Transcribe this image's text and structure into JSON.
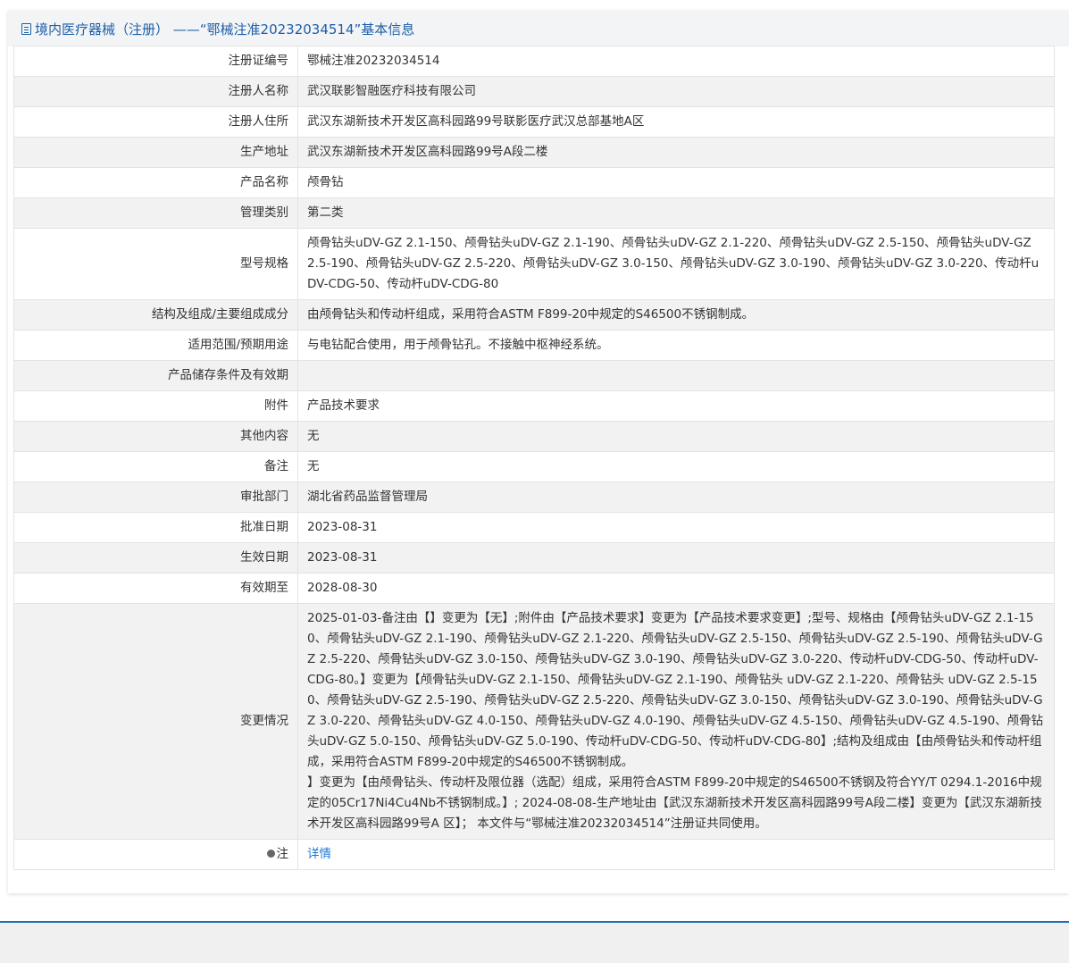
{
  "header": {
    "title": "境内医疗器械（注册） ——“鄂械注准20232034514”基本信息"
  },
  "rows": [
    {
      "label": "注册证编号",
      "value": "鄂械注准20232034514"
    },
    {
      "label": "注册人名称",
      "value": "武汉联影智融医疗科技有限公司"
    },
    {
      "label": "注册人住所",
      "value": "武汉东湖新技术开发区高科园路99号联影医疗武汉总部基地A区"
    },
    {
      "label": "生产地址",
      "value": "武汉东湖新技术开发区高科园路99号A段二楼"
    },
    {
      "label": "产品名称",
      "value": "颅骨钻"
    },
    {
      "label": "管理类别",
      "value": "第二类"
    },
    {
      "label": "型号规格",
      "value": "颅骨钻头uDV-GZ 2.1-150、颅骨钻头uDV-GZ 2.1-190、颅骨钻头uDV-GZ 2.1-220、颅骨钻头uDV-GZ 2.5-150、颅骨钻头uDV-GZ 2.5-190、颅骨钻头uDV-GZ 2.5-220、颅骨钻头uDV-GZ 3.0-150、颅骨钻头uDV-GZ 3.0-190、颅骨钻头uDV-GZ 3.0-220、传动杆uDV-CDG-50、传动杆uDV-CDG-80"
    },
    {
      "label": "结构及组成/主要组成成分",
      "value": "由颅骨钻头和传动杆组成，采用符合ASTM F899-20中规定的S46500不锈钢制成。"
    },
    {
      "label": "适用范围/预期用途",
      "value": "与电钻配合使用，用于颅骨钻孔。不接触中枢神经系统。"
    },
    {
      "label": "产品储存条件及有效期",
      "value": ""
    },
    {
      "label": "附件",
      "value": "产品技术要求"
    },
    {
      "label": "其他内容",
      "value": "无"
    },
    {
      "label": "备注",
      "value": "无"
    },
    {
      "label": "审批部门",
      "value": "湖北省药品监督管理局"
    },
    {
      "label": "批准日期",
      "value": "2023-08-31"
    },
    {
      "label": "生效日期",
      "value": "2023-08-31"
    },
    {
      "label": "有效期至",
      "value": "2028-08-30"
    },
    {
      "label": "变更情况",
      "value": "2025-01-03-备注由【】变更为【无】;附件由【产品技术要求】变更为【产品技术要求变更】;型号、规格由【颅骨钻头uDV-GZ 2.1-150、颅骨钻头uDV-GZ 2.1-190、颅骨钻头uDV-GZ 2.1-220、颅骨钻头uDV-GZ 2.5-150、颅骨钻头uDV-GZ 2.5-190、颅骨钻头uDV-GZ 2.5-220、颅骨钻头uDV-GZ 3.0-150、颅骨钻头uDV-GZ 3.0-190、颅骨钻头uDV-GZ 3.0-220、传动杆uDV-CDG-50、传动杆uDV-CDG-80。】变更为【颅骨钻头uDV-GZ 2.1-150、颅骨钻头uDV-GZ 2.1-190、颅骨钻头 uDV-GZ 2.1-220、颅骨钻头 uDV-GZ 2.5-150、颅骨钻头uDV-GZ 2.5-190、颅骨钻头uDV-GZ 2.5-220、颅骨钻头uDV-GZ 3.0-150、颅骨钻头uDV-GZ 3.0-190、颅骨钻头uDV-GZ 3.0-220、颅骨钻头uDV-GZ 4.0-150、颅骨钻头uDV-GZ 4.0-190、颅骨钻头uDV-GZ 4.5-150、颅骨钻头uDV-GZ 4.5-190、颅骨钻头uDV-GZ 5.0-150、颅骨钻头uDV-GZ 5.0-190、传动杆uDV-CDG-50、传动杆uDV-CDG-80】;结构及组成由【由颅骨钻头和传动杆组成，采用符合ASTM F899-20中规定的S46500不锈钢制成。\n】变更为【由颅骨钻头、传动杆及限位器（选配）组成，采用符合ASTM F899-20中规定的S46500不锈钢及符合YY/T 0294.1-2016中规定的05Cr17Ni4Cu4Nb不锈钢制成。】; 2024-08-08-生产地址由【武汉东湖新技术开发区高科园路99号A段二楼】变更为【武汉东湖新技术开发区高科园路99号A 区】； 本文件与“鄂械注准20232034514”注册证共同使用。"
    }
  ],
  "note_row": {
    "label": "注",
    "link": "详情"
  }
}
